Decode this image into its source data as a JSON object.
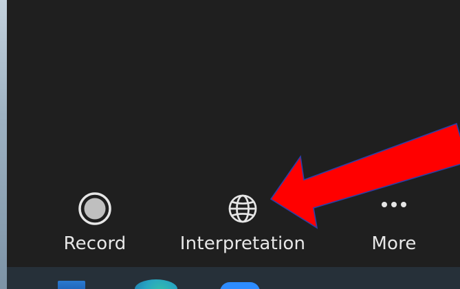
{
  "toolbar": {
    "buttons": [
      {
        "id": "record",
        "label": "Record",
        "icon": "record-icon"
      },
      {
        "id": "interpretation",
        "label": "Interpretation",
        "icon": "globe-icon"
      },
      {
        "id": "more",
        "label": "More",
        "icon": "ellipsis-icon"
      }
    ]
  },
  "taskbar": {
    "icons": [
      "windows-start-icon",
      "edge-browser-icon",
      "zoom-app-icon"
    ]
  },
  "annotation": {
    "shape": "red-arrow",
    "color": "#ff0000",
    "outline_color": "#2b3fa8"
  },
  "colors": {
    "panel_background": "#1f1f1f",
    "label_text": "#e8e8e8",
    "icon_color": "#e6e6e6",
    "taskbar_background": "#263039"
  }
}
